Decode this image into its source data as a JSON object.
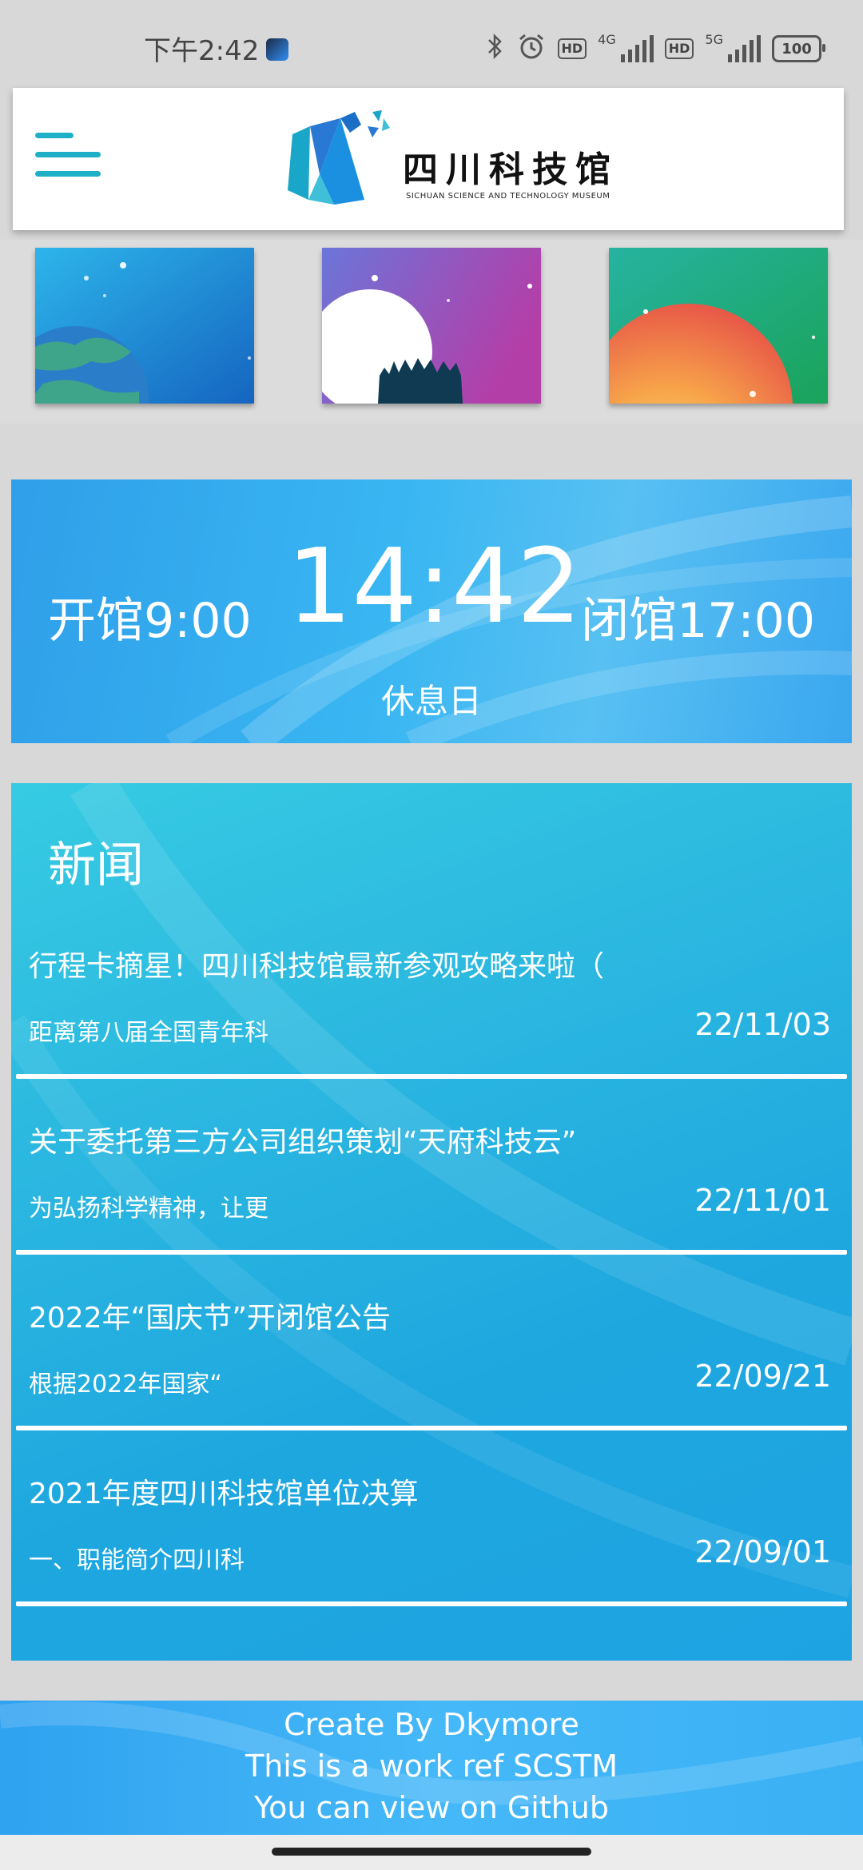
{
  "status_bar": {
    "time": "下午2:42",
    "network_1": "4G",
    "network_2": "5G",
    "hd_label": "HD",
    "battery": "100",
    "icons": [
      "bluetooth-icon",
      "alarm-icon",
      "signal-icon",
      "battery-icon"
    ]
  },
  "header": {
    "logo_cn": "四川科技馆",
    "logo_en": "SICHUAN SCIENCE AND TECHNOLOGY MUSEUM",
    "menu_icon": "hamburger-menu-icon"
  },
  "tiles": [
    {
      "name": "earth-tile",
      "colors": [
        "#2db5ea",
        "#1565c0"
      ]
    },
    {
      "name": "moon-forest-tile",
      "colors": [
        "#6b75d9",
        "#b43ea8"
      ]
    },
    {
      "name": "sun-tile",
      "colors": [
        "#26b3a0",
        "#1aa35a"
      ]
    }
  ],
  "hours": {
    "open_label": "开馆9:00",
    "clock": "14:42",
    "close_label": "闭馆17:00",
    "status": "休息日"
  },
  "news": {
    "title": "新闻",
    "items": [
      {
        "title": "行程卡摘星！四川科技馆最新参观攻略来啦（",
        "summary": "距离第八届全国青年科",
        "date": "22/11/03"
      },
      {
        "title": "关于委托第三方公司组织策划“天府科技云”",
        "summary": "为弘扬科学精神，让更",
        "date": "22/11/01"
      },
      {
        "title": "2022年“国庆节”开闭馆公告",
        "summary": "根据2022年国家“",
        "date": "22/09/21"
      },
      {
        "title": "2021年度四川科技馆单位决算",
        "summary": "一、职能简介四川科",
        "date": "22/09/01"
      }
    ]
  },
  "footer": {
    "line1": "Create By Dkymore",
    "line2": "This is a work ref SCSTM",
    "line3": "You can view on Github"
  },
  "colors": {
    "accent": "#1fb0c8",
    "hours_bg": "#39b6f2",
    "news_bg": "#2cb9e0",
    "footer_bg": "#45b8f8"
  }
}
